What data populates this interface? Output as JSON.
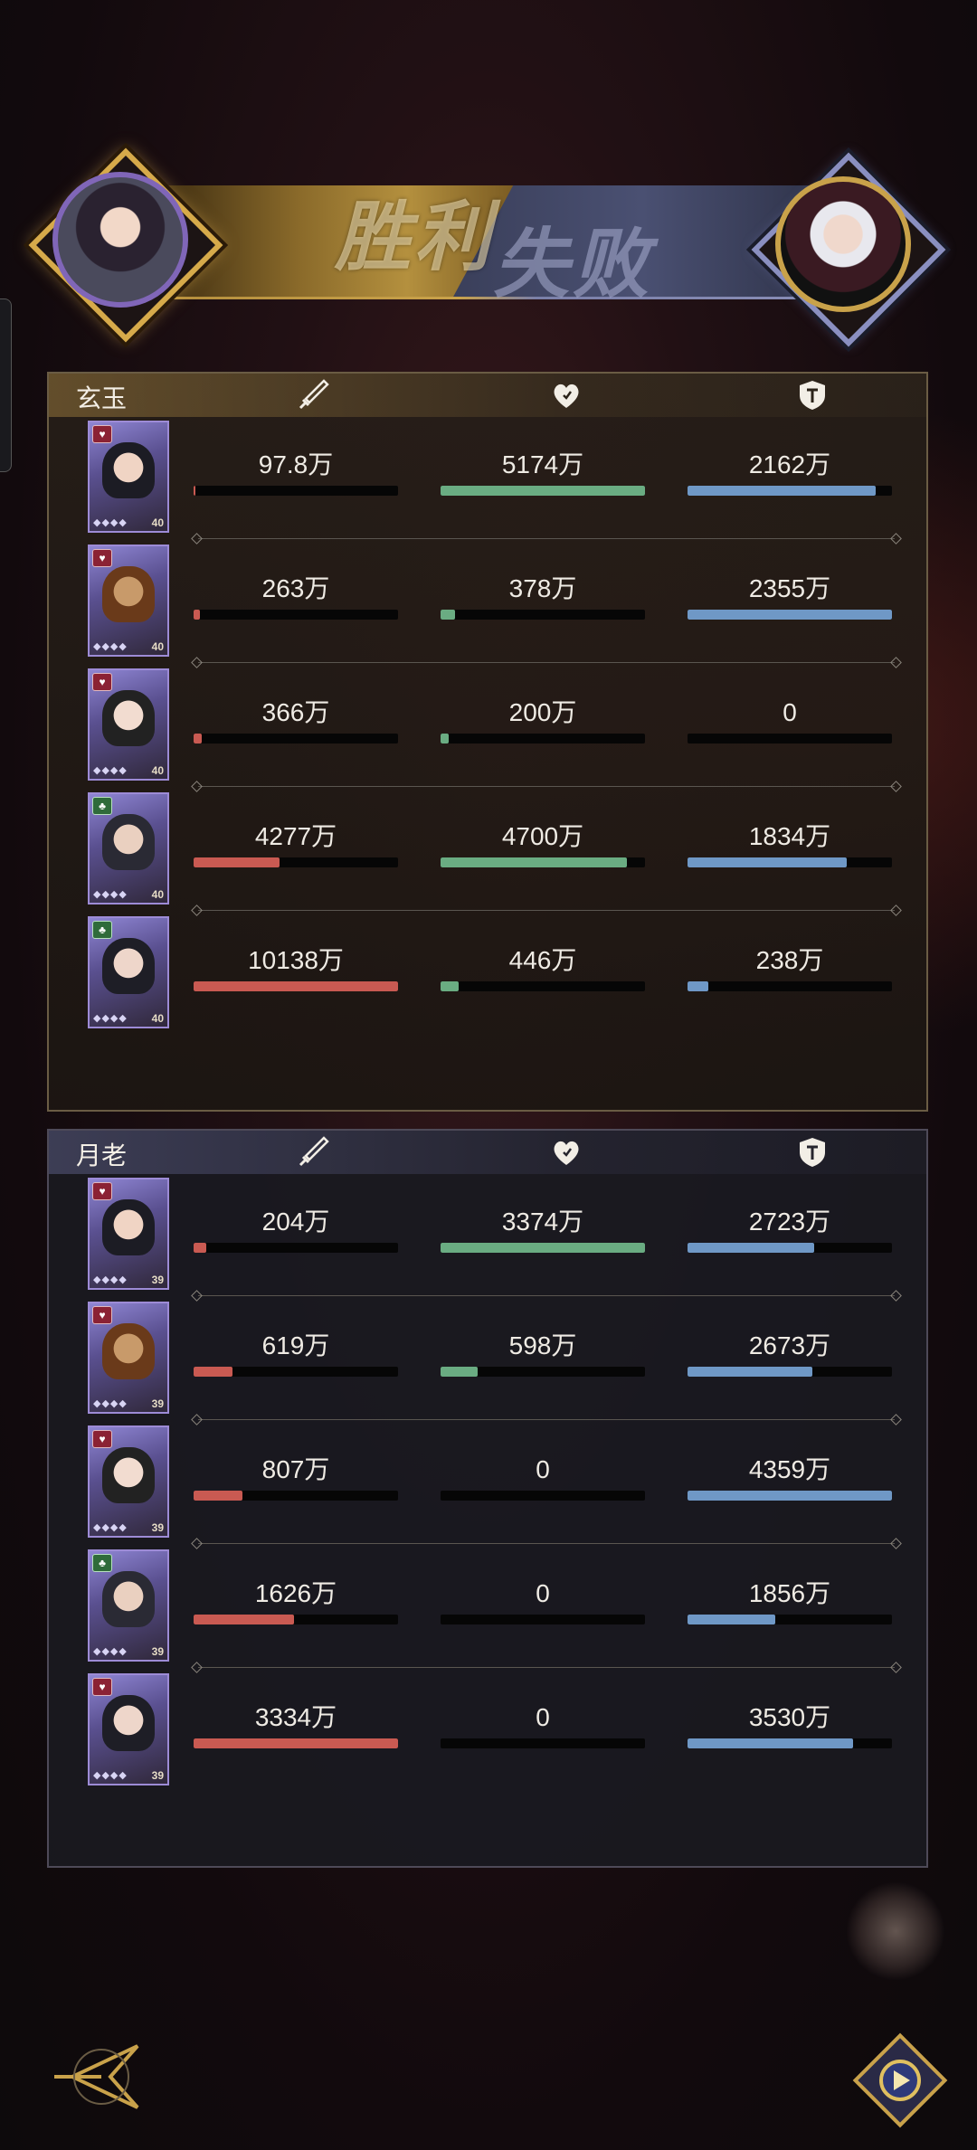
{
  "banner": {
    "win_label": "胜利",
    "lose_label": "失败"
  },
  "colors": {
    "attack": "#c95a52",
    "heal": "#6aac82",
    "defense": "#6f98c6",
    "win_gold": "#c9a24a",
    "lose_blue": "#7a7fa8"
  },
  "icons": {
    "attack": "sword-icon",
    "heal": "heart-icon",
    "defense": "shield-icon"
  },
  "teams": [
    {
      "name": "玄玉",
      "result": "win",
      "heroes": [
        {
          "atk": "97.8万",
          "atk_pct": 0.01,
          "heal": "5174万",
          "heal_pct": 1.0,
          "def": "2162万",
          "def_pct": 0.92,
          "badge": "heart",
          "level": "40"
        },
        {
          "atk": "263万",
          "atk_pct": 0.03,
          "heal": "378万",
          "heal_pct": 0.07,
          "def": "2355万",
          "def_pct": 1.0,
          "badge": "heart",
          "level": "40"
        },
        {
          "atk": "366万",
          "atk_pct": 0.04,
          "heal": "200万",
          "heal_pct": 0.04,
          "def": "0",
          "def_pct": 0.0,
          "badge": "heart",
          "level": "40"
        },
        {
          "atk": "4277万",
          "atk_pct": 0.42,
          "heal": "4700万",
          "heal_pct": 0.91,
          "def": "1834万",
          "def_pct": 0.78,
          "badge": "leaf",
          "level": "40"
        },
        {
          "atk": "10138万",
          "atk_pct": 1.0,
          "heal": "446万",
          "heal_pct": 0.09,
          "def": "238万",
          "def_pct": 0.1,
          "badge": "leaf",
          "level": "40"
        }
      ]
    },
    {
      "name": "月老",
      "result": "lose",
      "heroes": [
        {
          "atk": "204万",
          "atk_pct": 0.06,
          "heal": "3374万",
          "heal_pct": 1.0,
          "def": "2723万",
          "def_pct": 0.62,
          "badge": "heart",
          "level": "39"
        },
        {
          "atk": "619万",
          "atk_pct": 0.19,
          "heal": "598万",
          "heal_pct": 0.18,
          "def": "2673万",
          "def_pct": 0.61,
          "badge": "heart",
          "level": "39"
        },
        {
          "atk": "807万",
          "atk_pct": 0.24,
          "heal": "0",
          "heal_pct": 0.0,
          "def": "4359万",
          "def_pct": 1.0,
          "badge": "heart",
          "level": "39"
        },
        {
          "atk": "1626万",
          "atk_pct": 0.49,
          "heal": "0",
          "heal_pct": 0.0,
          "def": "1856万",
          "def_pct": 0.43,
          "badge": "leaf",
          "level": "39"
        },
        {
          "atk": "3334万",
          "atk_pct": 1.0,
          "heal": "0",
          "heal_pct": 0.0,
          "def": "3530万",
          "def_pct": 0.81,
          "badge": "heart",
          "level": "39"
        }
      ]
    }
  ]
}
